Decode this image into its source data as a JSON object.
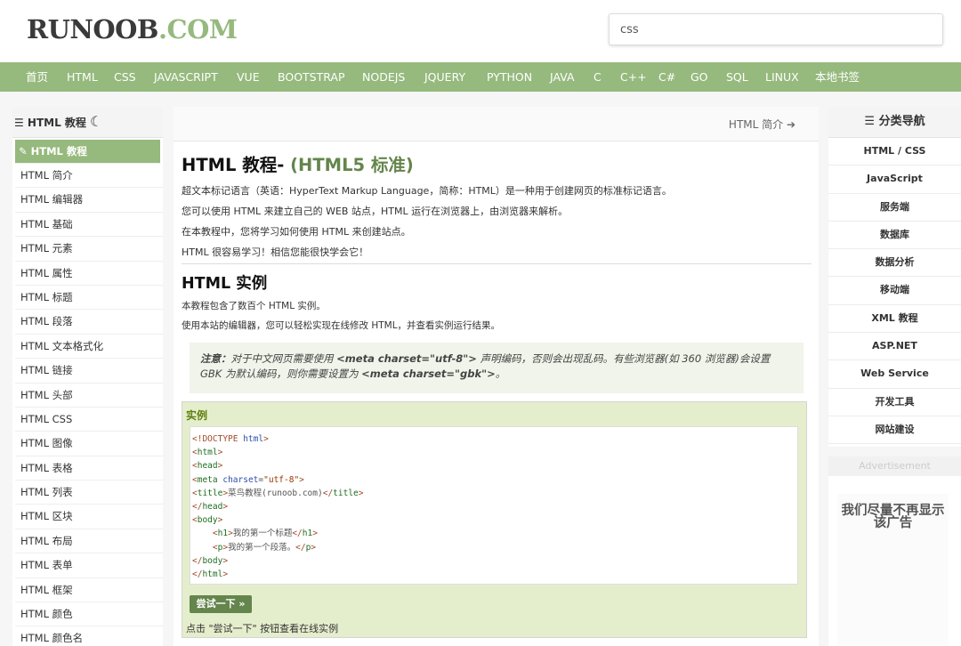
{
  "logo": {
    "part1": "RUNOOB",
    "part2": ".COM"
  },
  "search": {
    "value": "css"
  },
  "nav": [
    "首页",
    "HTML",
    "CSS",
    "JAVASCRIPT",
    "VUE",
    "BOOTSTRAP",
    "NODEJS",
    "JQUERY",
    "PYTHON",
    "JAVA",
    "C",
    "C++",
    "C#",
    "GO",
    "SQL",
    "LINUX",
    "本地书签"
  ],
  "left_sidebar": {
    "title": "☰ HTML 教程",
    "items": [
      "✎ HTML 教程",
      "HTML 简介",
      "HTML 编辑器",
      "HTML 基础",
      "HTML 元素",
      "HTML 属性",
      "HTML 标题",
      "HTML 段落",
      "HTML 文本格式化",
      "HTML 链接",
      "HTML 头部",
      "HTML CSS",
      "HTML 图像",
      "HTML 表格",
      "HTML 列表",
      "HTML 区块",
      "HTML 布局",
      "HTML 表单",
      "HTML 框架",
      "HTML 颜色",
      "HTML 颜色名"
    ]
  },
  "main": {
    "next_link": "HTML 简介 ➔",
    "title": "HTML 教程-",
    "title_sub": "(HTML5 标准)",
    "intro": [
      "超文本标记语言（英语：HyperText Markup Language，简称：HTML）是一种用于创建网页的标准标记语言。",
      "您可以使用 HTML 来建立自己的 WEB 站点，HTML 运行在浏览器上，由浏览器来解析。",
      "在本教程中，您将学习如何使用 HTML 来创建站点。",
      "HTML 很容易学习！相信您能很快学会它！"
    ],
    "section_title": "HTML 实例",
    "section_paras": [
      "本教程包含了数百个 HTML 实例。",
      "使用本站的编辑器，您可以轻松实现在线修改 HTML，并查看实例运行结果。"
    ],
    "note": {
      "label": "注意：",
      "text1": "对于中文网页需要使用 ",
      "code1": "<meta charset=\"utf-8\">",
      "text2": " 声明编码，否则会出现乱码。有些浏览器(如 360 浏览器)会设置 GBK 为默认编码，则你需要设置为 ",
      "code2": "<meta charset=\"gbk\">",
      "text3": "。"
    },
    "example": {
      "title": "实例",
      "try_button": "尝试一下 »",
      "hint": "点击 \"尝试一下\" 按钮查看在线实例"
    }
  },
  "right_sidebar": {
    "title": "☰ 分类导航",
    "items": [
      "HTML / CSS",
      "JavaScript",
      "服务端",
      "数据库",
      "数据分析",
      "移动端",
      "XML 教程",
      "ASP.NET",
      "Web Service",
      "开发工具",
      "网站建设"
    ]
  },
  "ad": {
    "label": "Advertisement",
    "text": "我们尽量不再显示该广告"
  }
}
